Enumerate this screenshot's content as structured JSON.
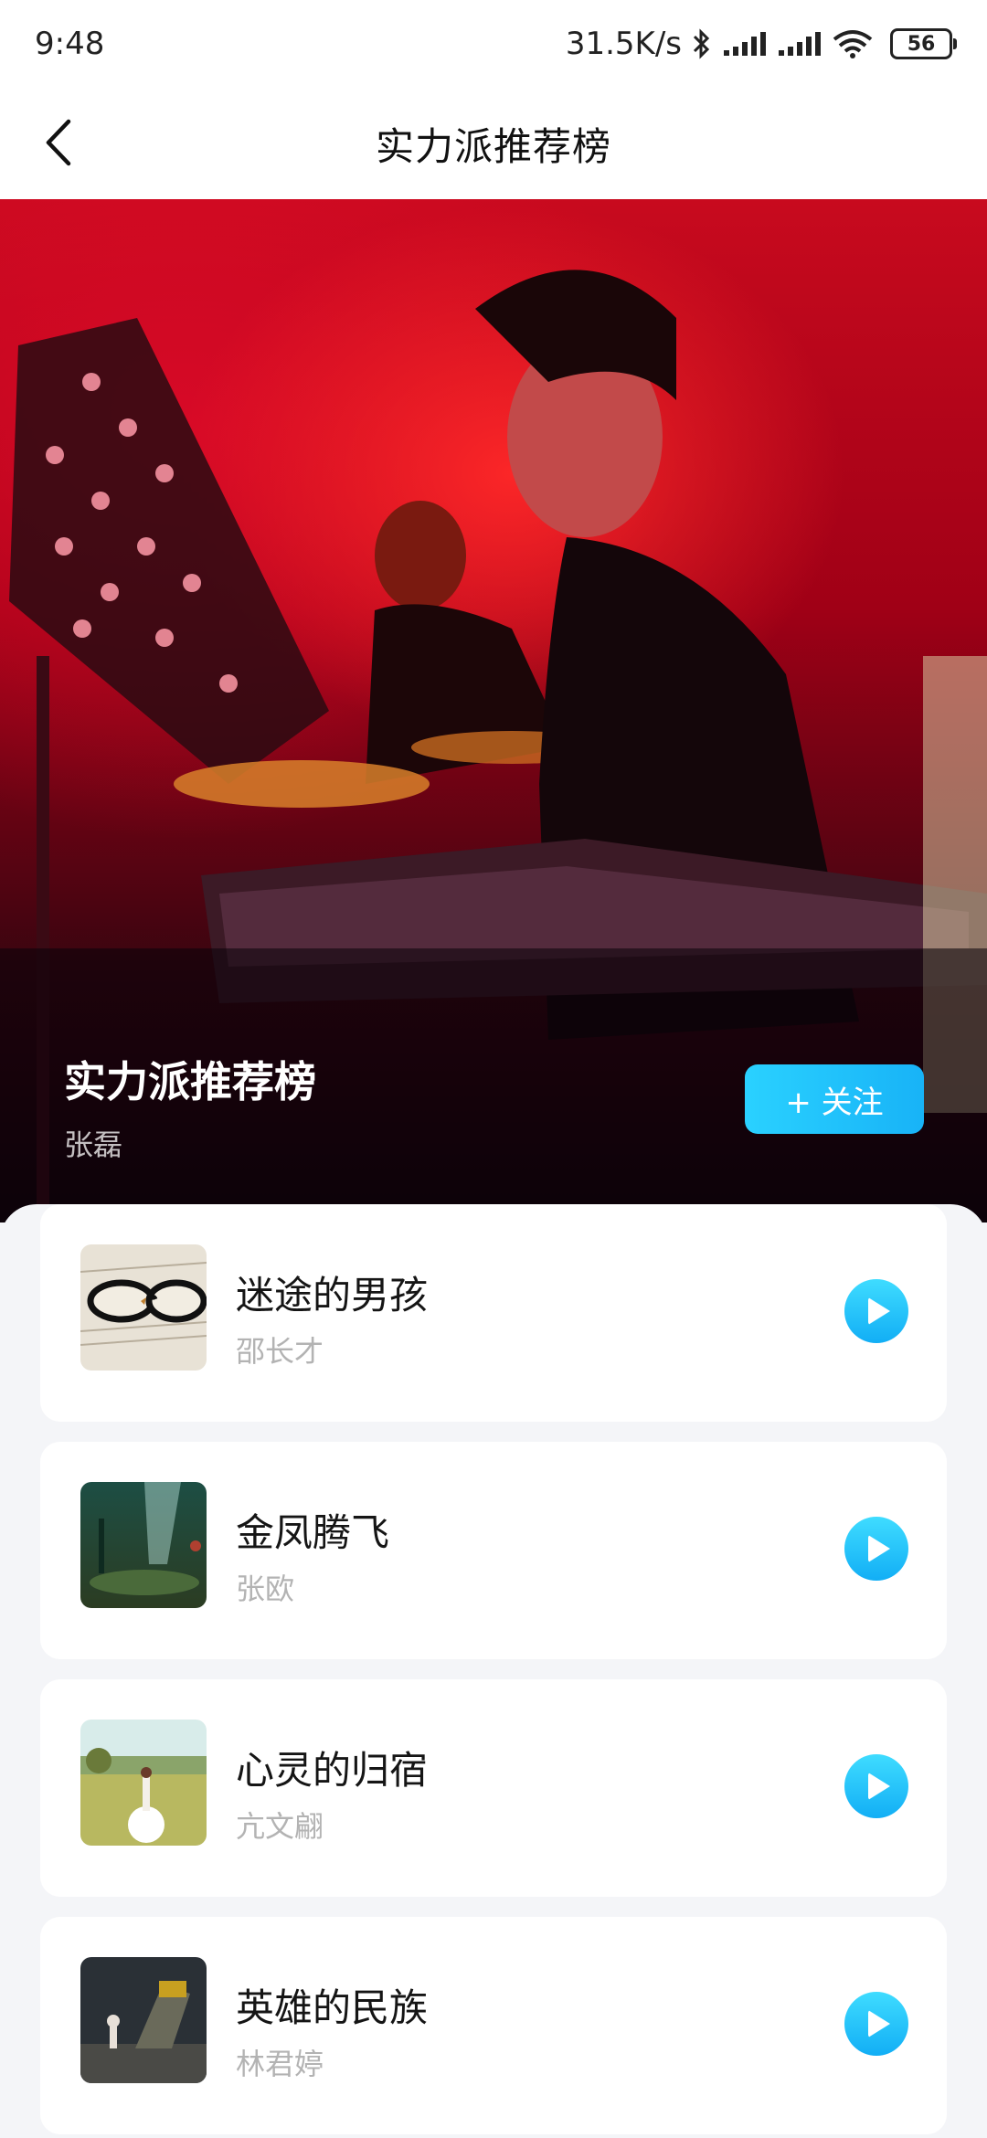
{
  "status_bar": {
    "time": "9:48",
    "speed": "31.5K/s",
    "battery": "56"
  },
  "header": {
    "title": "实力派推荐榜"
  },
  "hero": {
    "title": "实力派推荐榜",
    "author": "张磊",
    "follow_label": "+ 关注"
  },
  "songs": [
    {
      "title": "迷途的男孩",
      "artist": "邵长才"
    },
    {
      "title": "金凤腾飞",
      "artist": "张欧"
    },
    {
      "title": "心灵的归宿",
      "artist": "亢文翩"
    },
    {
      "title": "英雄的民族",
      "artist": "林君婷"
    }
  ],
  "colors": {
    "accent": "#18b3f7",
    "hero_red": "#c80a1e"
  }
}
